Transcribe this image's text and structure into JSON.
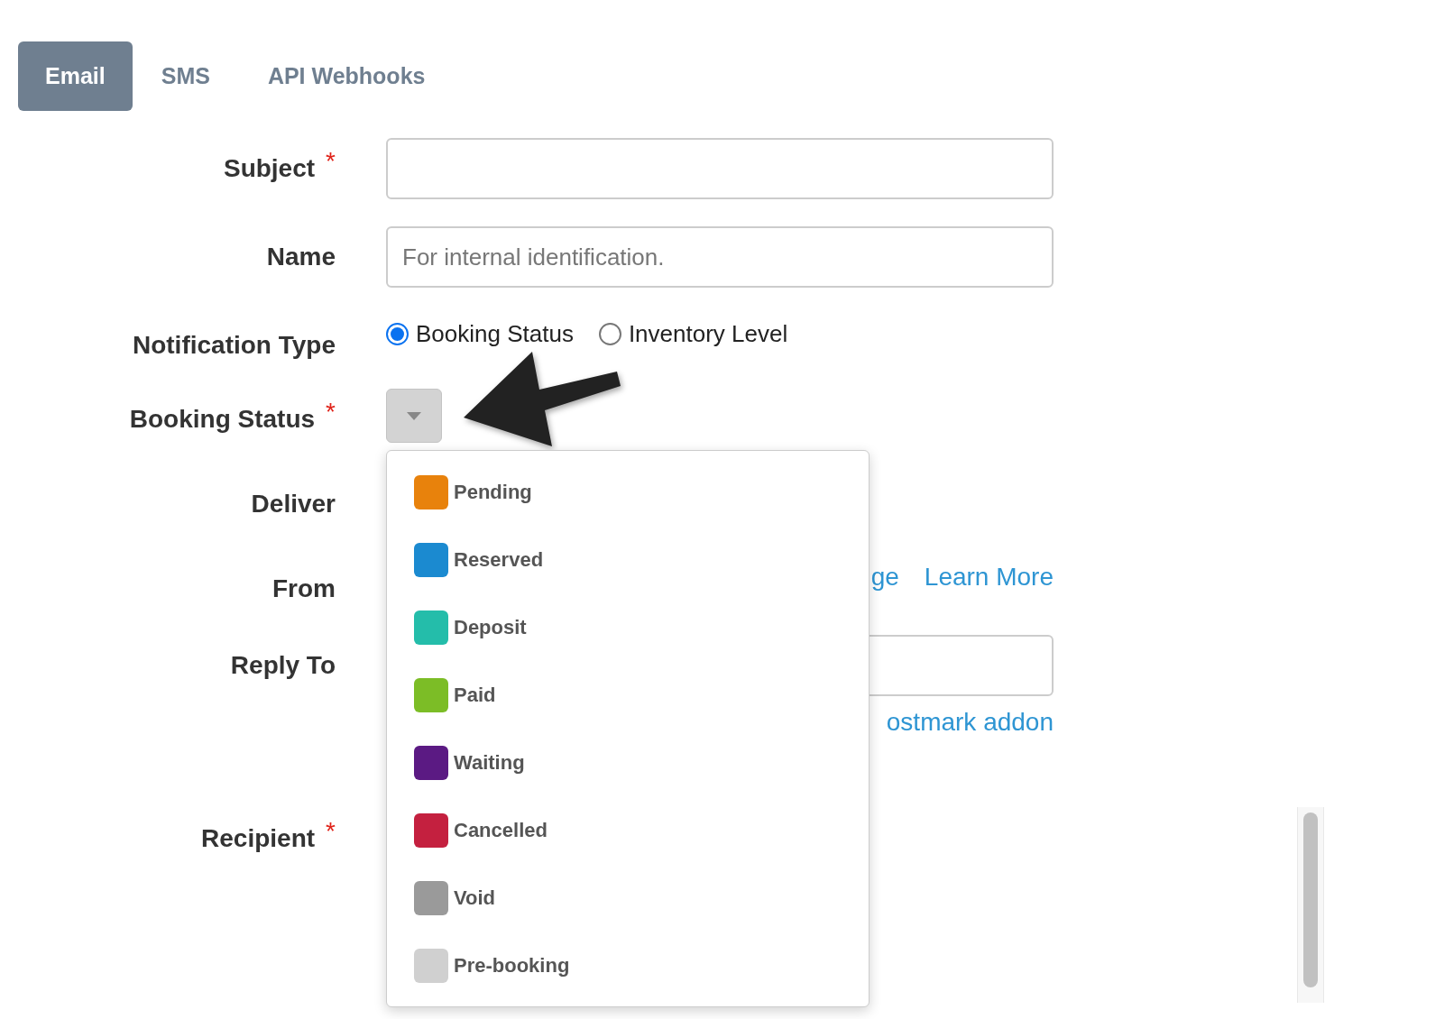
{
  "tabs": [
    {
      "label": "Email",
      "selected": true
    },
    {
      "label": "SMS",
      "selected": false
    },
    {
      "label": "API Webhooks",
      "selected": false
    }
  ],
  "rows": [
    {
      "kind": "input",
      "label": "Subject",
      "asterisk": "*"
    },
    {
      "kind": "input",
      "label": "Name",
      "placeholder": "For internal identification."
    },
    {
      "kind": "radios",
      "label": "Notification Type",
      "options": [
        {
          "label": "Booking Status",
          "selected": true
        },
        {
          "label": "Inventory Level",
          "selected": false
        }
      ]
    },
    {
      "kind": "select",
      "label": "Booking Status",
      "asterisk": "*"
    },
    {
      "kind": "covered",
      "label": "Deliver"
    },
    {
      "kind": "links",
      "label": "From",
      "links": [
        "ge",
        "Learn More"
      ]
    },
    {
      "kind": "input",
      "label": "Reply To",
      "link": "ostmark addon"
    },
    {
      "kind": "covered",
      "label": "Recipient",
      "asterisk": "*"
    }
  ],
  "dropdown": {
    "options": [
      {
        "label": "Pending",
        "color": "#e8820c"
      },
      {
        "label": "Reserved",
        "color": "#1b8ad0"
      },
      {
        "label": "Deposit",
        "color": "#24bdaa"
      },
      {
        "label": "Paid",
        "color": "#7cbd26"
      },
      {
        "label": "Waiting",
        "color": "#5b1a83"
      },
      {
        "label": "Cancelled",
        "color": "#c4203f"
      },
      {
        "label": "Void",
        "color": "#9a9a9a"
      },
      {
        "label": "Pre-booking",
        "color": "#d0d0d0"
      }
    ]
  }
}
